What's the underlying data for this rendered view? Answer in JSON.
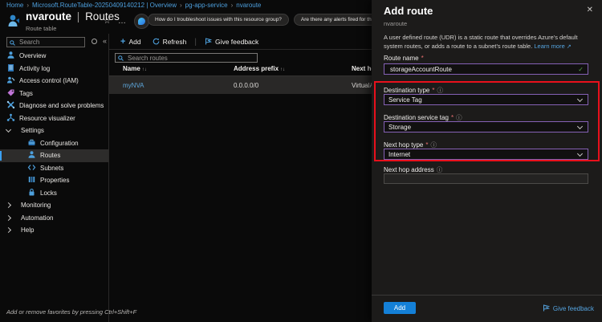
{
  "glyphs": {
    "star": "☆",
    "ellipsis": "…",
    "close": "✕",
    "collapse": "«",
    "info": "ⓘ",
    "external": "↗",
    "divider": "|",
    "plus": "+",
    "check": "✓"
  },
  "breadcrumb": [
    "Home",
    "Microsoft.RouteTable-20250409140212 | Overview",
    "pg-app-service",
    "nvaroute"
  ],
  "header": {
    "resource_name": "nvaroute",
    "separator": "|",
    "section": "Routes",
    "subtitle": "Route table",
    "suggestions": [
      "How do I troubleshoot issues with this resource group?",
      "Are there any alerts fired for this resource group?"
    ]
  },
  "sidebar": {
    "search_placeholder": "Search",
    "items": [
      "Overview",
      "Activity log",
      "Access control (IAM)",
      "Tags",
      "Diagnose and solve problems",
      "Resource visualizer",
      "Settings",
      "Configuration",
      "Routes",
      "Subnets",
      "Properties",
      "Locks",
      "Monitoring",
      "Automation",
      "Help"
    ],
    "favorites_hint": "Add or remove favorites by pressing Ctrl+Shift+F"
  },
  "toolbar": {
    "add": "Add",
    "refresh": "Refresh",
    "give_feedback": "Give feedback"
  },
  "routes_table": {
    "search_placeholder": "Search routes",
    "sort_glyph": "↑↓",
    "columns": [
      "Name",
      "Address prefix",
      "Next hop"
    ],
    "rows": [
      {
        "name": "myNVA",
        "address_prefix": "0.0.0.0/0",
        "next_hop": "VirtualAppliance"
      }
    ]
  },
  "panel": {
    "title": "Add route",
    "subtitle": "nvaroute",
    "description": "A user defined route (UDR) is a static route that overrides Azure's default system routes, or adds a route to a subnet's route table.",
    "learn_more": "Learn more",
    "required_marker": "*",
    "fields": {
      "route_name": {
        "label": "Route name",
        "value": "storageAccountRoute"
      },
      "destination_type": {
        "label": "Destination type",
        "value": "Service Tag"
      },
      "destination_service_tag": {
        "label": "Destination service tag",
        "value": "Storage"
      },
      "next_hop_type": {
        "label": "Next hop type",
        "value": "Internet"
      },
      "next_hop_address": {
        "label": "Next hop address",
        "value": ""
      }
    },
    "add_button": "Add",
    "give_feedback": "Give feedback"
  },
  "colors": {
    "accent": "#0078d4",
    "link": "#4da0dd",
    "annotation_red": "#e8101c",
    "input_border": "#8561b5",
    "valid_green": "#57a64a",
    "tag_purple": "#c075d8"
  }
}
